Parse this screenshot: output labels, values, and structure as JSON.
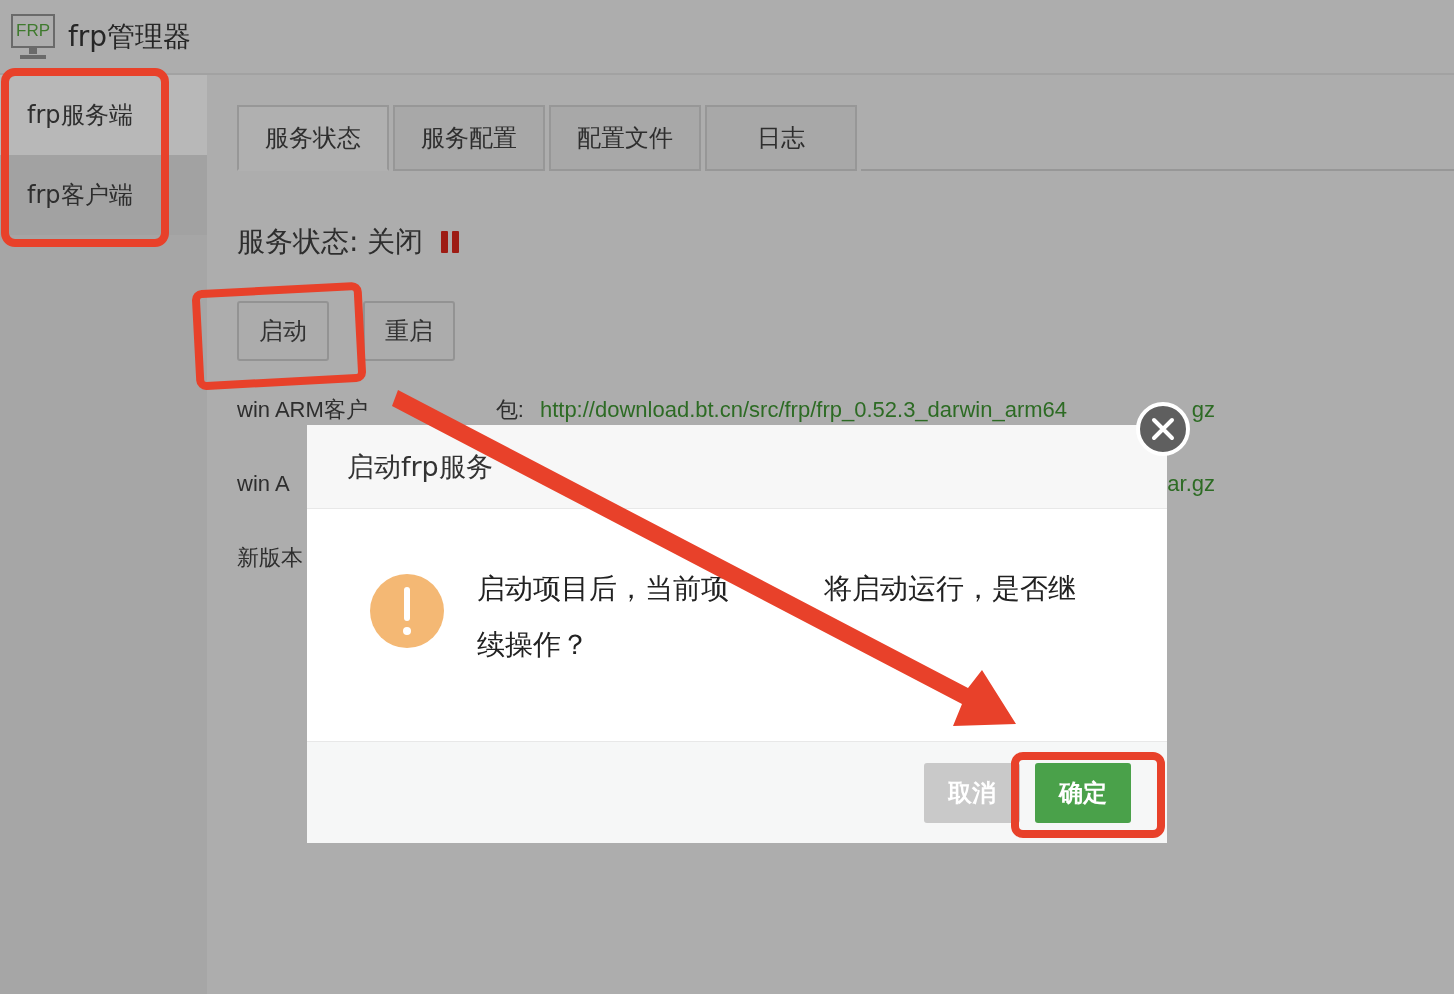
{
  "app": {
    "title": "frp管理器",
    "logo": "FRP"
  },
  "sidebar": {
    "items": [
      {
        "label": "frp服务端",
        "selected": true
      },
      {
        "label": "frp客户端",
        "selected": false
      }
    ]
  },
  "tabs": [
    {
      "label": "服务状态",
      "selected": true
    },
    {
      "label": "服务配置",
      "selected": false
    },
    {
      "label": "配置文件",
      "selected": false
    },
    {
      "label": "日志",
      "selected": false
    }
  ],
  "status": {
    "label": "服务状态: 关闭",
    "running": false
  },
  "buttons": [
    "启动",
    "重启"
  ],
  "downloads": [
    {
      "label": "win ARM客户",
      "label_end": "包:",
      "link": "http://download.bt.cn/src/frp/frp_0.52.3_darwin_arm64",
      "tail": "gz"
    },
    {
      "label": "win A",
      "tail": "ar.gz"
    },
    {
      "label": "新版本"
    }
  ],
  "dialog": {
    "title": "启动frp服务",
    "message": "启动项目后，当前项",
    "message_end": "将启动运行，是否继",
    "message_last": "续操作？",
    "buttons": [
      {
        "label": "取消",
        "kind": "cancel"
      },
      {
        "label": "确定",
        "kind": "confirm"
      }
    ]
  }
}
